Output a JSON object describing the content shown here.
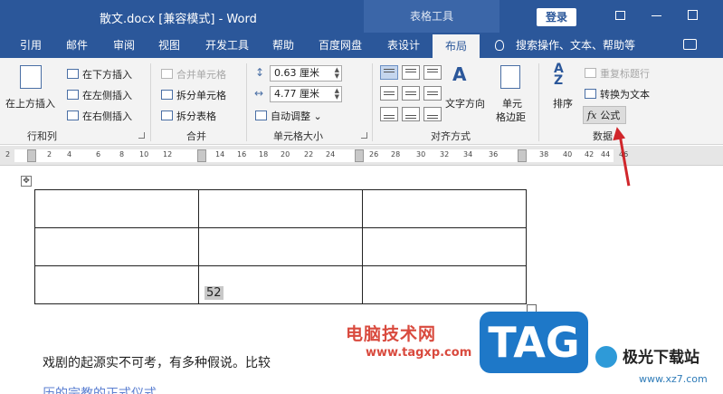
{
  "titlebar": {
    "doc_title": "散文.docx [兼容模式] - Word",
    "tools_title": "表格工具",
    "login_label": "登录"
  },
  "tabs": [
    {
      "label": "引用"
    },
    {
      "label": "邮件"
    },
    {
      "label": "审阅"
    },
    {
      "label": "视图"
    },
    {
      "label": "开发工具"
    },
    {
      "label": "帮助"
    },
    {
      "label": "百度网盘"
    },
    {
      "label": "表设计"
    },
    {
      "label": "布局"
    }
  ],
  "search_text": "搜索操作、文本、帮助等",
  "ribbon": {
    "rows_cols": {
      "insert_above": "在上方插入",
      "insert_below": "在下方插入",
      "insert_left": "在左侧插入",
      "insert_right": "在右侧插入",
      "group": "行和列"
    },
    "merge": {
      "merge_cells": "合并单元格",
      "split_cells": "拆分单元格",
      "split_table": "拆分表格",
      "group": "合并"
    },
    "cell_size": {
      "height": "0.63 厘米",
      "width": "4.77 厘米",
      "autofit": "自动调整",
      "group": "单元格大小"
    },
    "alignment": {
      "text_direction": "文字方向",
      "cell_margins_line1": "单元",
      "cell_margins_line2": "格边距",
      "group": "对齐方式"
    },
    "data": {
      "sort": "排序",
      "repeat_header": "重复标题行",
      "convert_text": "转换为文本",
      "formula": "公式",
      "group": "数据"
    }
  },
  "ruler_ticks": [
    "2",
    "2",
    "4",
    "6",
    "8",
    "10",
    "12",
    "14",
    "16",
    "18",
    "20",
    "22",
    "24",
    "26",
    "28",
    "30",
    "32",
    "34",
    "36",
    "38",
    "40",
    "42",
    "44",
    "46"
  ],
  "table": {
    "rows": [
      [
        "",
        "",
        ""
      ],
      [
        "",
        "",
        ""
      ],
      [
        "",
        "52",
        ""
      ]
    ]
  },
  "document": {
    "para1": "戏剧的起源实不可考，有多种假说。比较",
    "para2": "历的宗教的正式仪式"
  },
  "watermarks": {
    "cn": "电脑技术网",
    "url": "www.tagxp.com",
    "tag": "TAG",
    "site": "极光下载站",
    "site_url": "www.xz7.com"
  },
  "colors": {
    "brand": "#2b579a",
    "ribbon_bg": "#f3f3f3",
    "annotation": "#d0262b"
  }
}
